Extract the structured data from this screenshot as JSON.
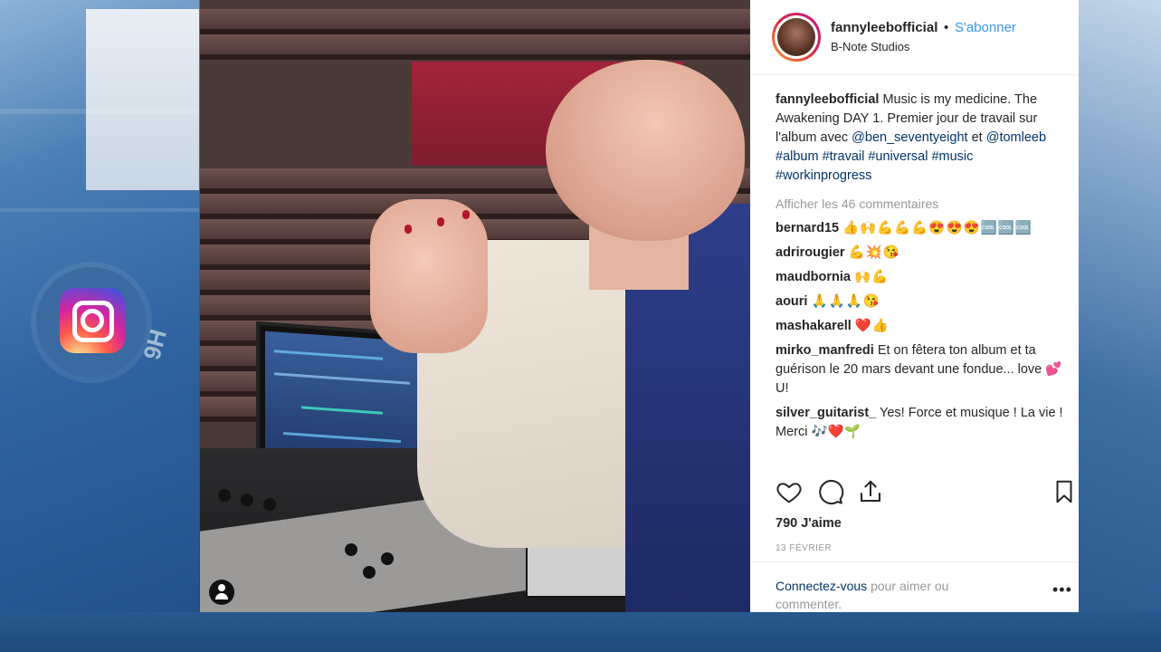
{
  "broadcast": {
    "channel_watermark": "9H"
  },
  "post": {
    "username": "fannyleebofficial",
    "separator": "•",
    "follow_label": "S'abonner",
    "location": "B-Note Studios",
    "caption": {
      "username": "fannyleebofficial",
      "text": "Music is my medicine. The Awakening DAY 1. Premier jour de travail sur l'album avec",
      "mention1": "@ben_seventyeight",
      "and": "et",
      "mention2": "@tomleeb",
      "hashtags": "#album #travail #universal #music #workinprogress"
    },
    "view_all_comments": "Afficher les 46 commentaires",
    "comments": [
      {
        "user": "bernard15",
        "text": "👍🙌💪💪💪😍😍😍🆒🆒🆒"
      },
      {
        "user": "adrirougier",
        "text": "💪💥😘"
      },
      {
        "user": "maudbornia",
        "text": "🙌💪"
      },
      {
        "user": "aouri",
        "text": "🙏🙏🙏😘"
      },
      {
        "user": "mashakarell",
        "text": "❤️👍"
      },
      {
        "user": "mirko_manfredi",
        "text": "Et on fêtera ton album et ta guérison le 20 mars devant une fondue... love 💕 U!"
      },
      {
        "user": "silver_guitarist_",
        "text": "Yes! Force et musique ! La vie ! Merci 🎶❤️🌱"
      }
    ],
    "likes": "790 J'aime",
    "date": "13 FÉVRIER",
    "login_link": "Connectez-vous",
    "login_rest": "pour aimer ou commenter.",
    "more": "•••"
  },
  "icons": [
    "heart-icon",
    "comment-icon",
    "share-icon",
    "bookmark-icon",
    "instagram-logo-icon",
    "user-tag-icon"
  ],
  "colors": {
    "link": "#3897f0",
    "tag": "#003569",
    "text": "#262626",
    "muted": "#999999"
  }
}
